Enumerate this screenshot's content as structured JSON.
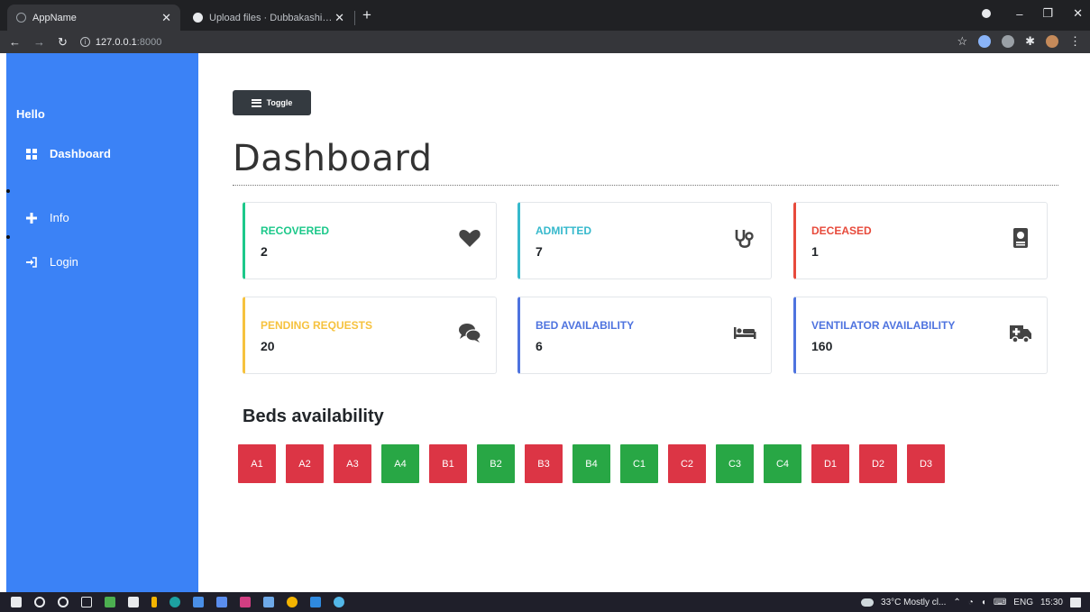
{
  "browser": {
    "tabs": [
      {
        "title": "AppName",
        "active": true
      },
      {
        "title": "Upload files · Dubbakashivareddy",
        "active": false
      }
    ],
    "url_host": "127.0.0.1",
    "url_port": ":8000"
  },
  "sidebar": {
    "greeting": "Hello",
    "items": [
      {
        "label": "Dashboard",
        "icon": "grid-icon"
      },
      {
        "label": "Info",
        "icon": "plus-icon"
      },
      {
        "label": "Login",
        "icon": "sign-in-icon"
      }
    ]
  },
  "main": {
    "toggle_label": "Toggle",
    "title": "Dashboard",
    "cards": [
      {
        "label": "RECOVERED",
        "value": "2",
        "color": "#1cc88a",
        "icon": "heart-icon"
      },
      {
        "label": "ADMITTED",
        "value": "7",
        "color": "#36b9cc",
        "icon": "stethoscope-icon"
      },
      {
        "label": "DECEASED",
        "value": "1",
        "color": "#e74a3b",
        "icon": "book-medical-icon"
      },
      {
        "label": "PENDING REQUESTS",
        "value": "20",
        "color": "#f6c23e",
        "icon": "comments-icon"
      },
      {
        "label": "BED AVAILABILITY",
        "value": "6",
        "color": "#4e73df",
        "icon": "bed-icon"
      },
      {
        "label": "VENTILATOR AVAILABILITY",
        "value": "160",
        "color": "#4e73df",
        "icon": "ambulance-icon"
      }
    ],
    "beds_title": "Beds availability",
    "beds": [
      {
        "label": "A1",
        "status": "occupied"
      },
      {
        "label": "A2",
        "status": "occupied"
      },
      {
        "label": "A3",
        "status": "occupied"
      },
      {
        "label": "A4",
        "status": "available"
      },
      {
        "label": "B1",
        "status": "occupied"
      },
      {
        "label": "B2",
        "status": "available"
      },
      {
        "label": "B3",
        "status": "occupied"
      },
      {
        "label": "B4",
        "status": "available"
      },
      {
        "label": "C1",
        "status": "available"
      },
      {
        "label": "C2",
        "status": "occupied"
      },
      {
        "label": "C3",
        "status": "available"
      },
      {
        "label": "C4",
        "status": "available"
      },
      {
        "label": "D1",
        "status": "occupied"
      },
      {
        "label": "D2",
        "status": "occupied"
      },
      {
        "label": "D3",
        "status": "occupied"
      }
    ],
    "bed_colors": {
      "occupied": "#dc3545",
      "available": "#28a745"
    }
  },
  "taskbar": {
    "weather": "33°C  Mostly cl...",
    "language": "ENG",
    "time": "15:30"
  }
}
